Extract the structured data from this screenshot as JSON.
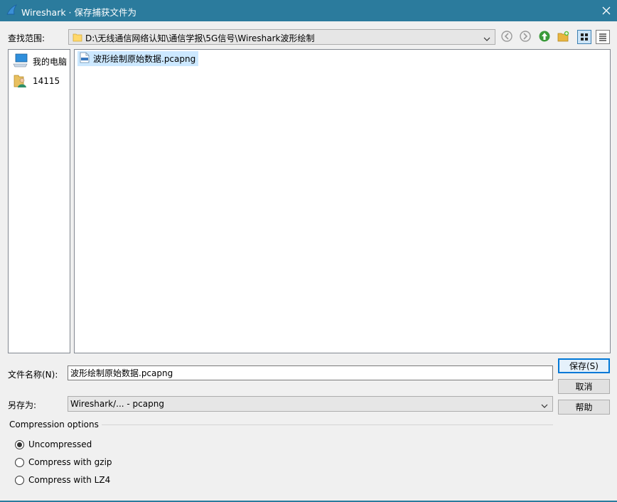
{
  "window": {
    "title": "Wireshark · 保存捕获文件为",
    "accent": "#2b7b9d"
  },
  "lookin": {
    "label": "查找范围:",
    "path": "D:\\无线通信网络认知\\通信学报\\5G信号\\Wireshark波形绘制"
  },
  "toolbar": {
    "icons": [
      "back-icon",
      "forward-icon",
      "up-folder-icon",
      "new-folder-icon",
      "list-view-icon",
      "detail-view-icon"
    ]
  },
  "sidebar": {
    "items": [
      {
        "label": "我的电脑",
        "icon": "computer-icon"
      },
      {
        "label": "14115",
        "icon": "user-folder-icon"
      }
    ]
  },
  "files": [
    {
      "name": "波形绘制原始数据.pcapng",
      "icon": "pcapng-file-icon",
      "selected": true
    }
  ],
  "filename": {
    "label": "文件名称(N):",
    "value": "波形绘制原始数据.pcapng"
  },
  "savetype": {
    "label": "另存为:",
    "value": "Wireshark/... - pcapng"
  },
  "buttons": {
    "save": "保存(S)",
    "cancel": "取消",
    "help": "帮助"
  },
  "compression": {
    "title": "Compression options",
    "options": [
      {
        "label": "Uncompressed",
        "checked": true
      },
      {
        "label": "Compress with gzip",
        "checked": false
      },
      {
        "label": "Compress with LZ4",
        "checked": false
      }
    ]
  }
}
